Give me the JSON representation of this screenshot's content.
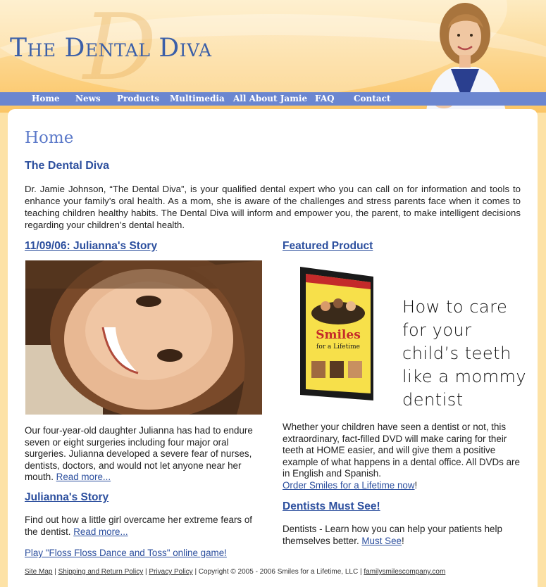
{
  "header": {
    "site_title": "The Dental Diva",
    "logo_letter": "D",
    "nav": [
      "Home",
      "News",
      "Products",
      "Multimedia",
      "All About Jamie",
      "FAQ",
      "Contact"
    ]
  },
  "main": {
    "page_title": "Home",
    "intro_heading": "The Dental Diva",
    "intro_text": "Dr. Jamie Johnson, “The Dental Diva”, is your qualified dental expert who you can call on for information and tools to enhance your family’s oral health. As a mom, she is aware of the challenges and stress parents face when it comes to teaching children healthy habits. The Dental Diva will inform and empower you, the parent, to make intelligent decisions regarding your children’s dental health."
  },
  "left": {
    "story_heading": "11/09/06: Julianna's Story",
    "story_text": "Our four-year-old daughter Julianna has had to endure seven or eight surgeries including four major oral surgeries. Julianna developed a severe fear of nurses, dentists, doctors, and would not let anyone near her mouth.",
    "read_more_1": "Read more...",
    "story2_heading": "Julianna's Story",
    "story2_text": "Find out how a little girl overcame her extreme fears of the dentist.",
    "read_more_2": "Read more...",
    "game_link": "Play \"Floss Floss Dance and Toss\" online game!"
  },
  "right": {
    "featured_heading": "Featured Product",
    "dvd_title": "Smiles",
    "dvd_subtitle": "for a Lifetime",
    "tagline": "How to care for your child’s teeth like a mommy dentist",
    "product_text": "Whether your children have seen a dentist or not, this extraordinary, fact-filled DVD will make caring for their teeth at HOME easier, and will give them a positive example of what happens in a dental office. All DVDs are in English and Spanish.",
    "order_link": "Order Smiles for a Lifetime now",
    "order_suffix": "!",
    "dentists_heading": "Dentists Must See!",
    "dentists_text": "Dentists - Learn how you can help your patients help themselves better.",
    "must_see_link": "Must See",
    "must_see_suffix": "!"
  },
  "footer": {
    "site_map": "Site Map",
    "shipping": "Shipping and Return Policy",
    "privacy": "Privacy Policy",
    "copyright": "Copyright © 2005 - 2006 Smiles for a Lifetime, LLC",
    "domain": "familysmilescompany.com",
    "sep": " | "
  }
}
